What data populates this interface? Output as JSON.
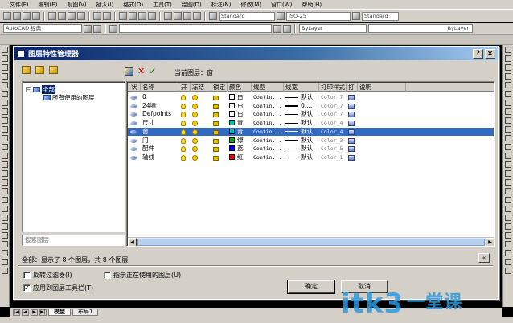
{
  "menubar": {
    "items": [
      "文件(F)",
      "编辑(E)",
      "视图(V)",
      "插入(I)",
      "格式(O)",
      "工具(T)",
      "绘图(D)",
      "标注(N)",
      "修改(M)",
      "窗口(W)",
      "帮助(H)"
    ]
  },
  "toolbar": {
    "text_style": "Standard",
    "dim_style": "ISO-25",
    "table_style": "Standard",
    "workspace": "AutoCAD 经典",
    "color": "ByLayer",
    "linetype": "ByLayer"
  },
  "dialog": {
    "title": "图层特性管理器",
    "current_layer_label": "当前图层：窗",
    "tree": {
      "root": "全部",
      "child": "所有使用的图层"
    },
    "search_placeholder": "搜索图层",
    "columns": [
      "状",
      "名称",
      "开",
      "冻结",
      "锁定",
      "颜色",
      "线型",
      "线宽",
      "打印样式",
      "打",
      "说明"
    ],
    "layers": [
      {
        "name": "0",
        "color_name": "白",
        "color": "#ffffff",
        "linetype": "Contin...",
        "lineweight": "默认",
        "plot_style": "Color_7",
        "thick": false
      },
      {
        "name": "24墙",
        "color_name": "白",
        "color": "#ffffff",
        "linetype": "Contin...",
        "lineweight": "0....",
        "plot_style": "Color_7",
        "thick": true
      },
      {
        "name": "Defpoints",
        "color_name": "白",
        "color": "#ffffff",
        "linetype": "Contin...",
        "lineweight": "默认",
        "plot_style": "Color_7",
        "thick": false
      },
      {
        "name": "尺寸",
        "color_name": "青",
        "color": "#00c0c0",
        "linetype": "Contin...",
        "lineweight": "默认",
        "plot_style": "Color_4",
        "thick": false
      },
      {
        "name": "窗",
        "color_name": "青",
        "color": "#00c0c0",
        "linetype": "Contin...",
        "lineweight": "默认",
        "plot_style": "Color_4",
        "thick": false,
        "selected": true
      },
      {
        "name": "门",
        "color_name": "绿",
        "color": "#00b000",
        "linetype": "Contin...",
        "lineweight": "默认",
        "plot_style": "Color_3",
        "thick": false
      },
      {
        "name": "配件",
        "color_name": "蓝",
        "color": "#0000ff",
        "linetype": "Contin...",
        "lineweight": "默认",
        "plot_style": "Color_5",
        "thick": false
      },
      {
        "name": "轴线",
        "color_name": "红",
        "color": "#ff0000",
        "linetype": "Contin...",
        "lineweight": "默认",
        "plot_style": "Color_1",
        "thick": false
      }
    ],
    "status": "全部：显示了 8 个图层，共 8 个图层",
    "invert_filter_label": "反转过滤器(I)",
    "show_used_label": "指示正在使用的图层(U)",
    "apply_toolbar_label": "应用到图层工具栏(T)",
    "ok_label": "确定",
    "cancel_label": "取消"
  },
  "bottom": {
    "model_tab": "模型",
    "layout1_tab": "布局1"
  },
  "watermark": {
    "text": "itk3",
    "suffix": "一堂课"
  }
}
